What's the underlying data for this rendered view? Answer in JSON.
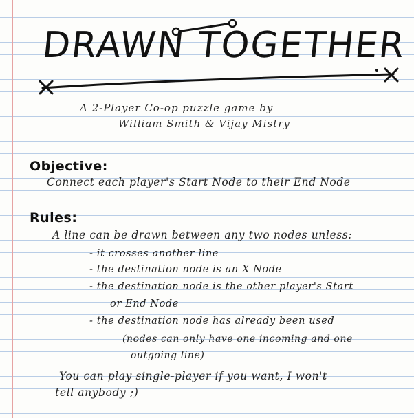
{
  "title": "DRAWN TOGETHER",
  "subtitle_line1": "A 2-Player Co-op puzzle game by",
  "subtitle_line2": "William Smith & Vijay Mistry",
  "objective": {
    "heading": "Objective:",
    "text": "Connect each player's Start Node to their End Node"
  },
  "rules": {
    "heading": "Rules:",
    "intro": "A line can be drawn between any two nodes unless:",
    "items": [
      "- it crosses another line",
      "- the destination node is an X Node",
      "- the destination node is the other player's Start",
      "or End Node",
      "- the destination node has already been used",
      "(nodes can only have one incoming and one",
      "outgoing line)"
    ]
  },
  "closing_line1": "You can play single-player if you want, I won't",
  "closing_line2": "tell anybody ;)",
  "colors": {
    "ink": "#1a1a1a",
    "rule_line": "#b9cde6",
    "margin_line": "#e6a3a3",
    "paper": "#fdfdfb"
  },
  "icons": [
    "start-node-circle-icon",
    "x-node-icon"
  ]
}
